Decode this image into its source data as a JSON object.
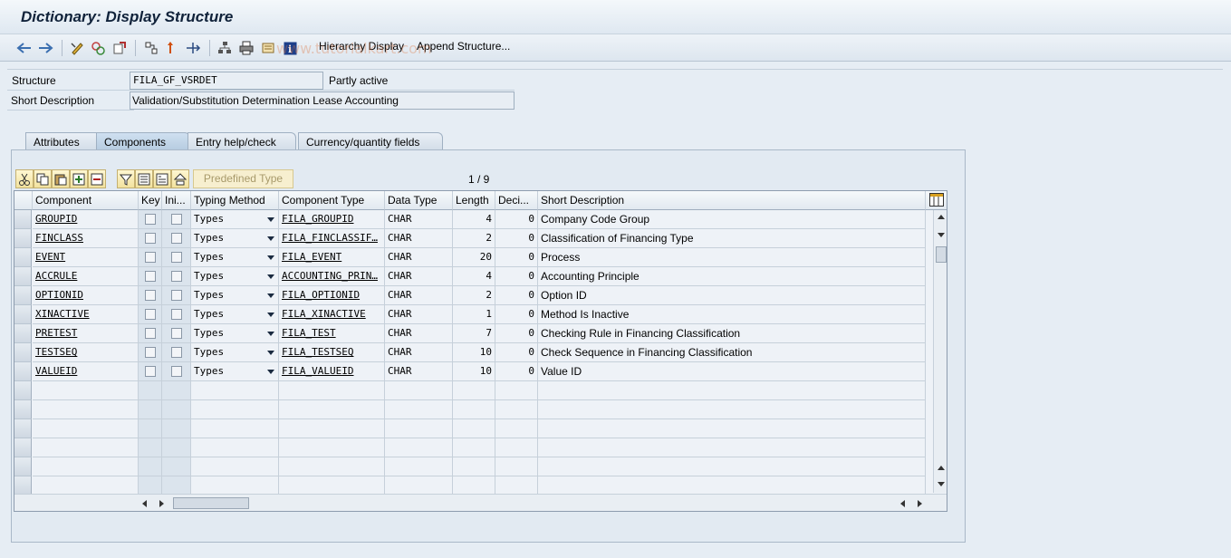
{
  "window": {
    "title": "Dictionary: Display Structure"
  },
  "toolbar": {
    "hierarchy_label": "Hierarchy Display",
    "append_label": "Append Structure...",
    "icons": [
      "back-arrow-icon",
      "forward-arrow-icon",
      "display-change-icon",
      "other-object-icon",
      "activate-icon",
      "where-used-icon",
      "navigation-icon",
      "tree-icon",
      "print-icon",
      "documentation-icon",
      "info-icon"
    ]
  },
  "watermark": "www.tutorialkart.com",
  "header": {
    "structure_label": "Structure",
    "structure_value": "FILA_GF_VSRDET",
    "status": "Partly active",
    "shortdesc_label": "Short Description",
    "shortdesc_value": "Validation/Substitution Determination Lease Accounting"
  },
  "tabs": [
    {
      "label": "Attributes",
      "active": false
    },
    {
      "label": "Components",
      "active": true
    },
    {
      "label": "Entry help/check",
      "active": false
    },
    {
      "label": "Currency/quantity fields",
      "active": false
    }
  ],
  "grid_toolbar": {
    "predefined_type_label": "Predefined Type",
    "pager": "1 / 9"
  },
  "columns": [
    "Component",
    "Key",
    "Ini...",
    "Typing Method",
    "Component Type",
    "Data Type",
    "Length",
    "Deci...",
    "Short Description"
  ],
  "rows": [
    {
      "component": "GROUPID",
      "typing": "Types",
      "comp_type": "FILA_GROUPID",
      "data_type": "CHAR",
      "length": "4",
      "decimals": "0",
      "desc": "Company Code Group"
    },
    {
      "component": "FINCLASS",
      "typing": "Types",
      "comp_type": "FILA_FINCLASSIF…",
      "data_type": "CHAR",
      "length": "2",
      "decimals": "0",
      "desc": "Classification of Financing Type"
    },
    {
      "component": "EVENT",
      "typing": "Types",
      "comp_type": "FILA_EVENT",
      "data_type": "CHAR",
      "length": "20",
      "decimals": "0",
      "desc": "Process"
    },
    {
      "component": "ACCRULE",
      "typing": "Types",
      "comp_type": "ACCOUNTING_PRIN…",
      "data_type": "CHAR",
      "length": "4",
      "decimals": "0",
      "desc": "Accounting Principle"
    },
    {
      "component": "OPTIONID",
      "typing": "Types",
      "comp_type": "FILA_OPTIONID",
      "data_type": "CHAR",
      "length": "2",
      "decimals": "0",
      "desc": "Option ID"
    },
    {
      "component": "XINACTIVE",
      "typing": "Types",
      "comp_type": "FILA_XINACTIVE",
      "data_type": "CHAR",
      "length": "1",
      "decimals": "0",
      "desc": "Method Is Inactive"
    },
    {
      "component": "PRETEST",
      "typing": "Types",
      "comp_type": "FILA_TEST",
      "data_type": "CHAR",
      "length": "7",
      "decimals": "0",
      "desc": "Checking Rule in Financing Classification"
    },
    {
      "component": "TESTSEQ",
      "typing": "Types",
      "comp_type": "FILA_TESTSEQ",
      "data_type": "CHAR",
      "length": "10",
      "decimals": "0",
      "desc": "Check Sequence in Financing Classification"
    },
    {
      "component": "VALUEID",
      "typing": "Types",
      "comp_type": "FILA_VALUEID",
      "data_type": "CHAR",
      "length": "10",
      "decimals": "0",
      "desc": "Value ID"
    }
  ],
  "colors": {
    "background": "#e6edf4",
    "header_bg": "#e2e9f0",
    "key_column": "#dbe4ed"
  }
}
